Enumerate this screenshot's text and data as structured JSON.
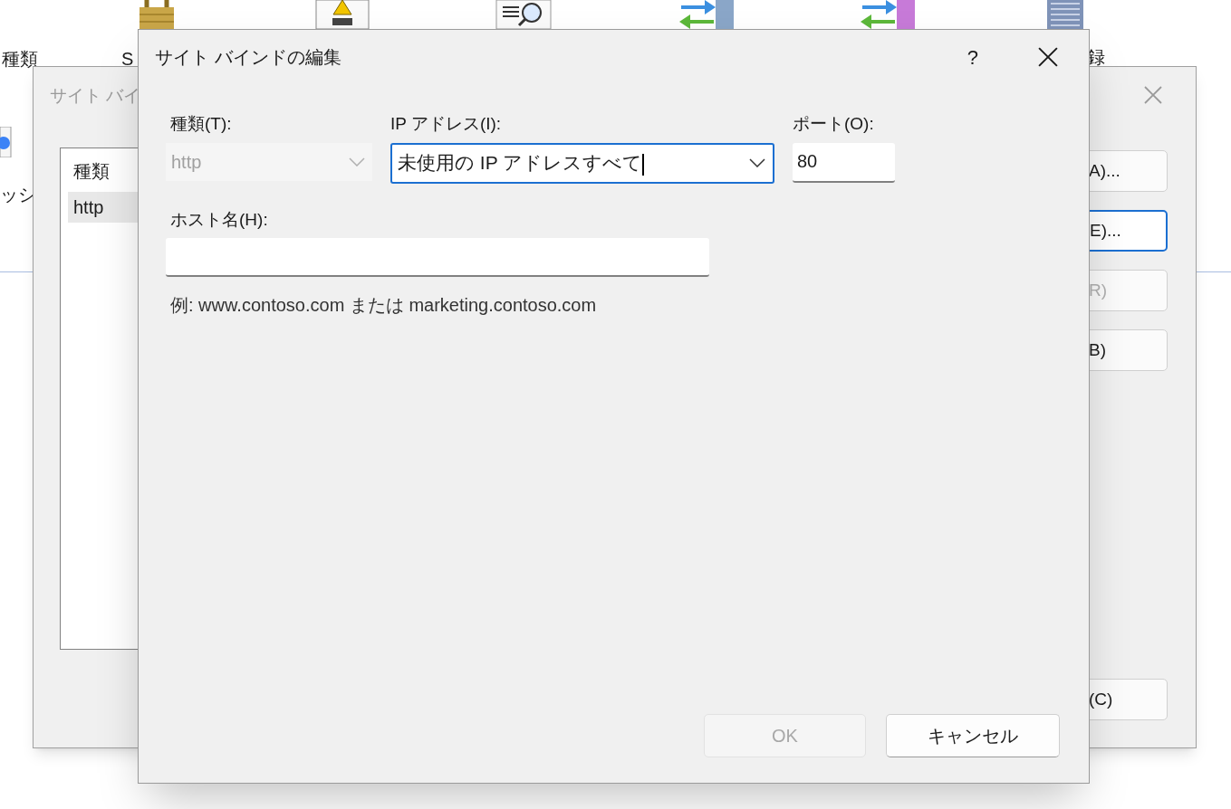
{
  "desktop": {
    "labels": [
      {
        "text": "種類"
      },
      {
        "text": "S"
      },
      {
        "text": "録"
      },
      {
        "text": "ッシ"
      }
    ]
  },
  "back_dialog": {
    "title": "サイト バイ",
    "list": {
      "header": "種類",
      "rows": [
        {
          "text": "http",
          "selected": true
        }
      ]
    },
    "buttons": [
      {
        "label": "A)...",
        "disabled": false,
        "focused": false
      },
      {
        "label": "E)...",
        "disabled": false,
        "focused": true
      },
      {
        "label": "R)",
        "disabled": true,
        "focused": false
      },
      {
        "label": "B)",
        "disabled": false,
        "focused": false
      }
    ],
    "close_button": {
      "label": "(C)",
      "disabled": false,
      "focused": false
    }
  },
  "dialog": {
    "title": "サイト バインドの編集",
    "help": "?",
    "type": {
      "label": "種類(T):",
      "value": "http",
      "disabled": true
    },
    "ip": {
      "label": "IP アドレス(I):",
      "value": "未使用の IP アドレスすべて",
      "focused": true
    },
    "port": {
      "label": "ポート(O):",
      "value": "80"
    },
    "host": {
      "label": "ホスト名(H):"
    },
    "example": "例: www.contoso.com または marketing.contoso.com",
    "buttons": [
      {
        "label": "OK",
        "disabled": true
      },
      {
        "label": "キャンセル",
        "disabled": false
      }
    ]
  }
}
